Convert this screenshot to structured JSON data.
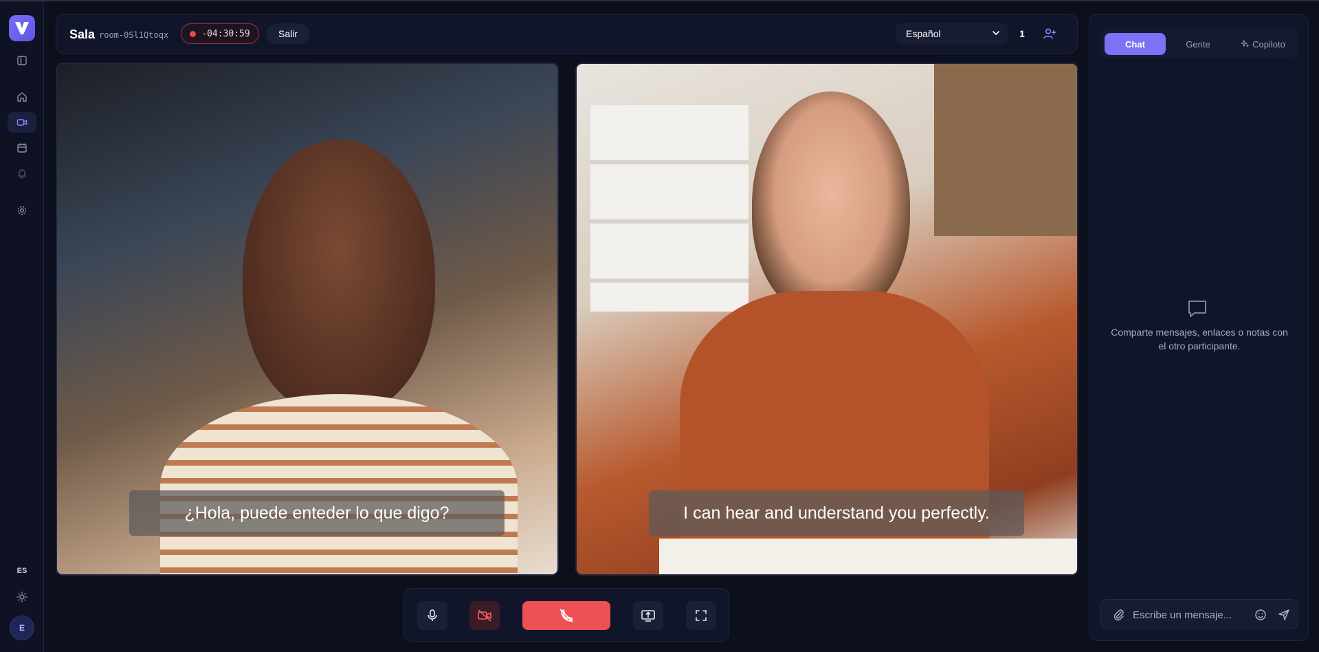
{
  "rail": {
    "language": "ES",
    "avatar_initial": "E",
    "icons": [
      "sidebar-toggle-icon",
      "home-icon",
      "video-icon",
      "calendar-icon",
      "bell-icon",
      "gear-icon",
      "sun-icon"
    ]
  },
  "header": {
    "title": "Sala",
    "room_id": "room-0Sl1Qtoqx",
    "timer": "-04:30:59",
    "leave_label": "Salir",
    "language": "Español",
    "participant_count": "1"
  },
  "videos": {
    "left_caption": "¿Hola, puede enteder lo que digo?",
    "right_caption": "I can hear and understand you perfectly."
  },
  "panel": {
    "tabs": [
      {
        "label": "Chat"
      },
      {
        "label": "Gente"
      },
      {
        "label": "Copiloto"
      }
    ],
    "empty_text": "Comparte mensajes, enlaces o notas con el otro participante.",
    "composer_placeholder": "Escribe un mensaje..."
  },
  "colors": {
    "accent": "#7b72f5",
    "end_call": "#ef4f57",
    "background": "#0c0f1c"
  }
}
